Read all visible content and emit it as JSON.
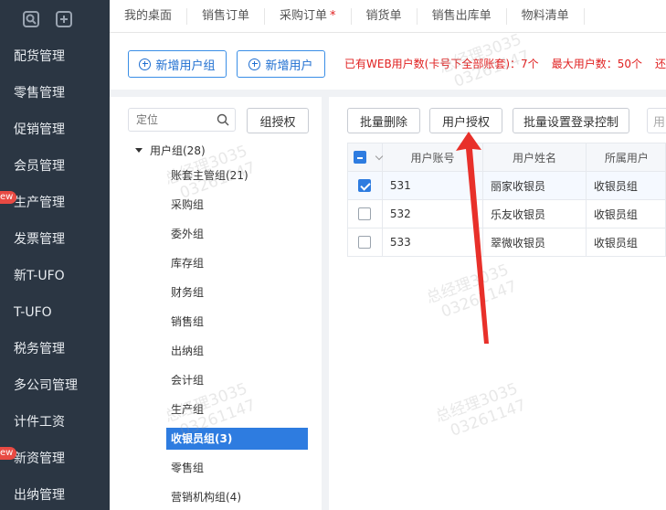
{
  "sidebar": {
    "items": [
      {
        "label": "配货管理",
        "badge": ""
      },
      {
        "label": "零售管理",
        "badge": ""
      },
      {
        "label": "促销管理",
        "badge": ""
      },
      {
        "label": "会员管理",
        "badge": ""
      },
      {
        "label": "生产管理",
        "badge": "ew"
      },
      {
        "label": "发票管理",
        "badge": ""
      },
      {
        "label": "新T-UFO",
        "badge": ""
      },
      {
        "label": "T-UFO",
        "badge": ""
      },
      {
        "label": "税务管理",
        "badge": ""
      },
      {
        "label": "多公司管理",
        "badge": ""
      },
      {
        "label": "计件工资",
        "badge": ""
      },
      {
        "label": "新资管理",
        "badge": "ew"
      },
      {
        "label": "出纳管理",
        "badge": ""
      }
    ]
  },
  "tabs": [
    {
      "label": "我的桌面"
    },
    {
      "label": "销售订单"
    },
    {
      "label": "采购订单",
      "star": "*"
    },
    {
      "label": "销货单"
    },
    {
      "label": "销售出库单"
    },
    {
      "label": "物料清单"
    }
  ],
  "toolbar": {
    "add_group": "新增用户组",
    "add_user": "新增用户",
    "web_users": "已有WEB用户数(卡号下全部账套)：7个",
    "max_users": "最大用户数：50个",
    "trail": "还"
  },
  "tree": {
    "search_placeholder": "定位",
    "group_auth": "组授权",
    "root": "用户组(28)",
    "nodes": [
      {
        "label": "账套主管组(21)"
      },
      {
        "label": "采购组"
      },
      {
        "label": "委外组"
      },
      {
        "label": "库存组"
      },
      {
        "label": "财务组"
      },
      {
        "label": "销售组"
      },
      {
        "label": "出纳组"
      },
      {
        "label": "会计组"
      },
      {
        "label": "生产组"
      },
      {
        "label": "收银员组(3)"
      },
      {
        "label": "零售组"
      },
      {
        "label": "营销机构组(4)"
      }
    ],
    "selected": "收银员组(3)"
  },
  "table_toolbar": {
    "batch_delete": "批量删除",
    "user_auth": "用户授权",
    "batch_login": "批量设置登录控制",
    "partial_input": "用"
  },
  "table": {
    "headers": [
      "用户账号",
      "用户姓名",
      "所属用户"
    ],
    "rows": [
      {
        "account": "531",
        "name": "丽家收银员",
        "group": "收银员组",
        "checked": true
      },
      {
        "account": "532",
        "name": "乐友收银员",
        "group": "收银员组",
        "checked": false
      },
      {
        "account": "533",
        "name": "翠微收银员",
        "group": "收银员组",
        "checked": false
      }
    ]
  },
  "watermark": {
    "line1": "总经理3035",
    "line2": "03261147"
  },
  "colors": {
    "sidebar_bg": "#2b3643",
    "accent": "#2e7ce0",
    "alert_red": "#e02020"
  }
}
